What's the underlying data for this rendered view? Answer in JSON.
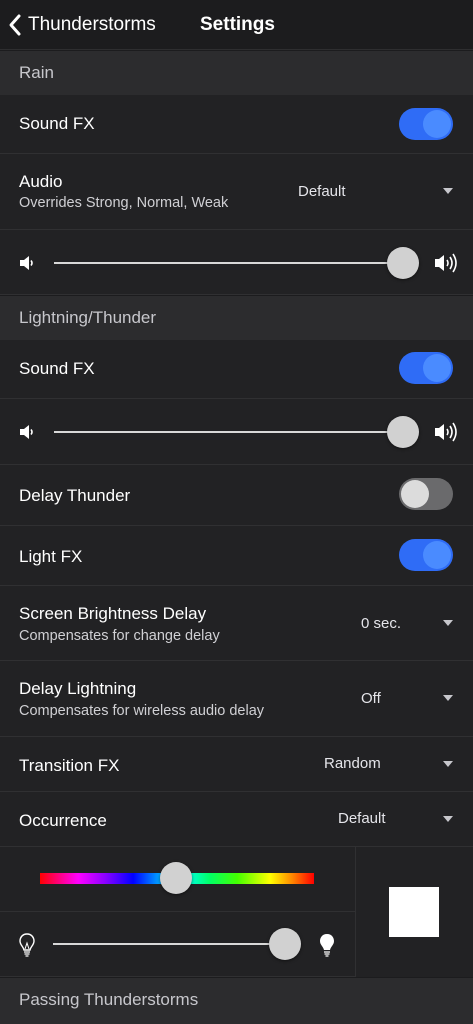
{
  "nav": {
    "back_label": "Thunderstorms",
    "title": "Settings"
  },
  "rain": {
    "header": "Rain",
    "sound_fx": {
      "label": "Sound FX",
      "on": true
    },
    "audio": {
      "label": "Audio",
      "sublabel": "Overrides Strong, Normal, Weak",
      "value": "Default"
    },
    "volume": {
      "level": 1.0
    }
  },
  "lightning": {
    "header": "Lightning/Thunder",
    "sound_fx": {
      "label": "Sound FX",
      "on": true
    },
    "volume": {
      "level": 1.0
    },
    "delay_thunder": {
      "label": "Delay Thunder",
      "on": false
    },
    "light_fx": {
      "label": "Light FX",
      "on": true
    },
    "screen_brightness_delay": {
      "label": "Screen Brightness Delay",
      "sublabel": "Compensates for change delay",
      "value": "0 sec."
    },
    "delay_lightning": {
      "label": "Delay Lightning",
      "sublabel": "Compensates for wireless audio delay",
      "value": "Off"
    },
    "transition_fx": {
      "label": "Transition FX",
      "value": "Random"
    },
    "occurrence": {
      "label": "Occurrence",
      "value": "Default"
    },
    "color": {
      "hue_position": 0.5,
      "swatch_color": "#ffffff"
    },
    "brightness": {
      "level": 1.0
    }
  },
  "passing": {
    "header": "Passing Thunderstorms"
  },
  "colors": {
    "accent": "#2f6cf6",
    "background": "#1c1c1e",
    "row": "#222224",
    "header": "#2c2c2e"
  },
  "icons": {
    "back": "chevron-left-icon",
    "volume_low": "speaker-low-icon",
    "volume_high": "speaker-high-icon",
    "bulb_off": "bulb-outline-icon",
    "bulb_on": "bulb-filled-icon",
    "dropdown": "caret-down-icon"
  }
}
